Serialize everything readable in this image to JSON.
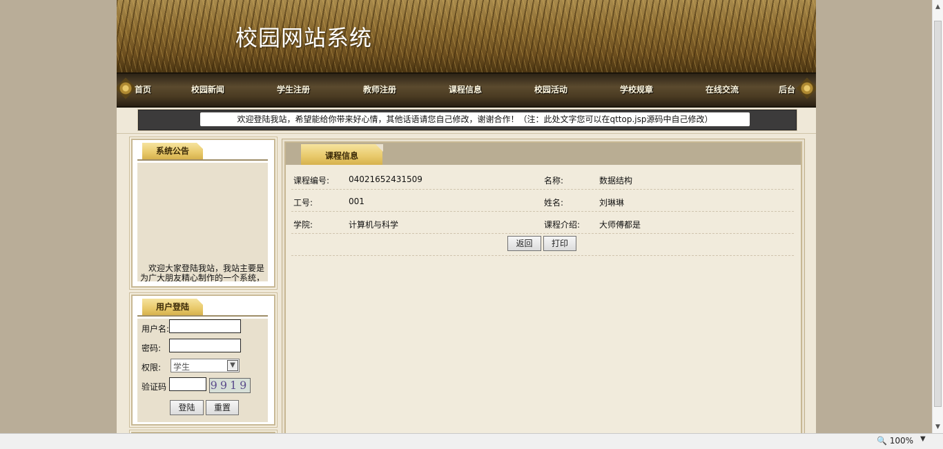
{
  "site": {
    "title": "校园网站系统"
  },
  "nav": {
    "items": [
      {
        "label": "首页"
      },
      {
        "label": "校园新闻"
      },
      {
        "label": "学生注册"
      },
      {
        "label": "教师注册"
      },
      {
        "label": "课程信息"
      },
      {
        "label": "校园活动"
      },
      {
        "label": "学校规章"
      },
      {
        "label": "在线交流"
      },
      {
        "label": "后台"
      }
    ]
  },
  "marquee": {
    "text": "欢迎登陆我站，希望能给你带来好心情，其他话语请您自己修改，谢谢合作！（注：此处文字您可以在qttop.jsp源码中自己修改）"
  },
  "notice": {
    "title": "系统公告",
    "text": "欢迎大家登陆我站，我站主要是为广大朋友精心制作的一个系统，"
  },
  "login": {
    "title": "用户登陆",
    "username_label": "用户名:",
    "username_value": "",
    "password_label": "密码:",
    "password_value": "",
    "role_label": "权限:",
    "role_value": "学生",
    "captcha_label": "验证码",
    "captcha_value": "",
    "captcha_image_text": "9919",
    "login_button": "登陆",
    "reset_button": "重置"
  },
  "course": {
    "tab_title": "课程信息",
    "rows": [
      {
        "label1": "课程编号:",
        "value1": "04021652431509",
        "label2": "名称:",
        "value2": "数据结构"
      },
      {
        "label1": "工号:",
        "value1": "001",
        "label2": "姓名:",
        "value2": "刘琳琳"
      },
      {
        "label1": "学院:",
        "value1": "计算机与科学",
        "label2": "课程介绍:",
        "value2": "大师傅都是"
      }
    ],
    "back_button": "返回",
    "print_button": "打印"
  },
  "statusbar": {
    "zoom": "100%"
  }
}
